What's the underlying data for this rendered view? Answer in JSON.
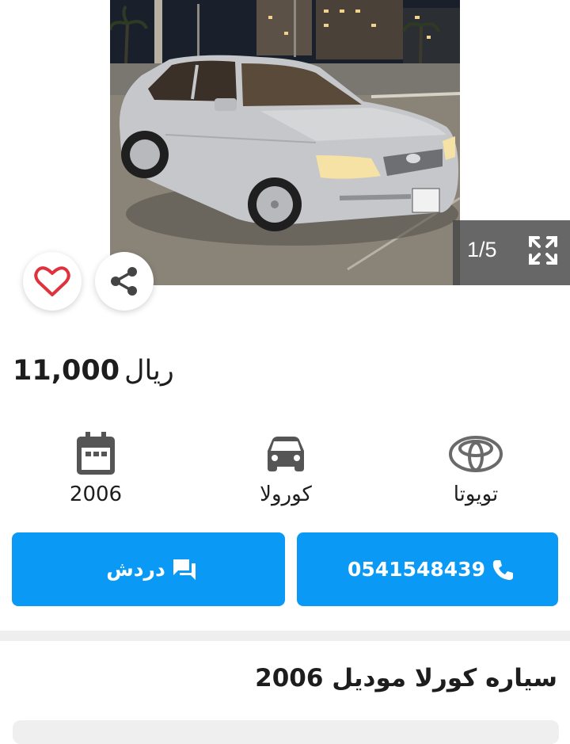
{
  "gallery": {
    "counter": "1/5",
    "photo_alt": "silver sedan photo",
    "icons": {
      "prev": "chevron-left-icon",
      "next": "chevron-right-icon",
      "expand": "expand-icon",
      "favorite": "heart-icon",
      "share": "share-icon"
    }
  },
  "listing": {
    "price_value": "11,000",
    "price_currency": "ريال",
    "title": "سياره كورلا موديل 2006"
  },
  "specs": {
    "year": "2006",
    "model": "كورولا",
    "make": "تويوتا"
  },
  "actions": {
    "chat_label": "دردش",
    "phone_label": "0541548439"
  },
  "colors": {
    "accent": "#0a9af5",
    "heart": "#e0313c",
    "divider": "#eeeeee"
  }
}
